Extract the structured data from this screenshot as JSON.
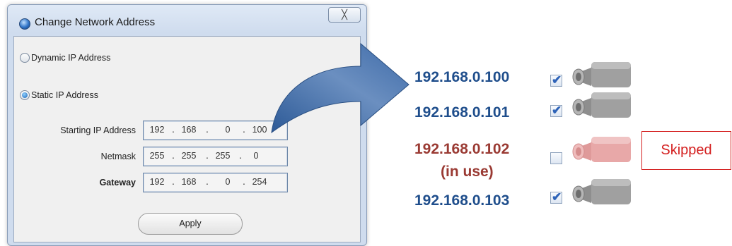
{
  "window": {
    "title": "Change Network Address",
    "close_label": "╳"
  },
  "mode": {
    "dynamic_label": "Dynamic IP Address",
    "static_label": "Static IP Address",
    "selected": "static"
  },
  "fields": {
    "starting_ip": {
      "label": "Starting IP Address",
      "octets": [
        "192",
        "168",
        "0",
        "100"
      ]
    },
    "netmask": {
      "label": "Netmask",
      "octets": [
        "255",
        "255",
        "255",
        "0"
      ]
    },
    "gateway": {
      "label": "Gateway",
      "octets": [
        "192",
        "168",
        "0",
        "254"
      ]
    }
  },
  "apply_label": "Apply",
  "cameras": [
    {
      "ip": "192.168.0.100",
      "checked": true
    },
    {
      "ip": "192.168.0.101",
      "checked": true
    },
    {
      "ip": "192.168.0.102",
      "note": "(in use)",
      "checked": false
    },
    {
      "ip": "192.168.0.103",
      "checked": true
    }
  ],
  "skipped_label": "Skipped",
  "colors": {
    "ip_normal": "#1f4e8c",
    "ip_in_use": "#9a3a33",
    "skipped": "#d42020",
    "camera_gray": "#9b9b9b",
    "camera_red": "#e4a3a3",
    "arrow": "#3a659e"
  }
}
